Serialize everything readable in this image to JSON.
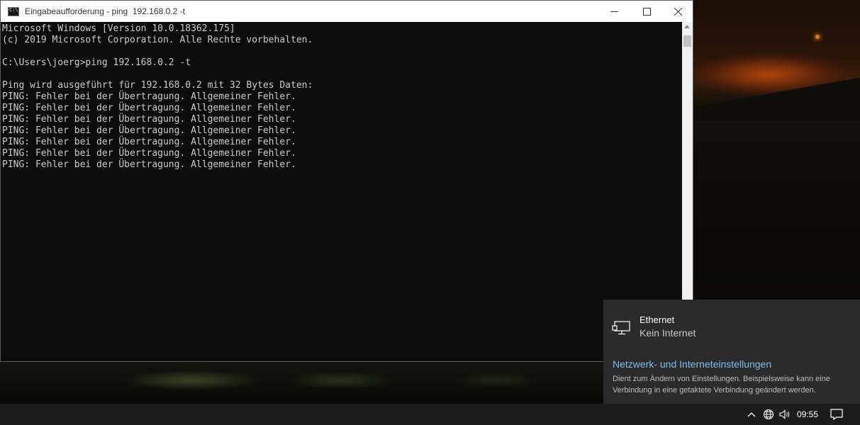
{
  "window": {
    "title": "Eingabeaufforderung - ping  192.168.0.2 -t",
    "icon": "cmd-icon"
  },
  "console": {
    "lines": [
      "Microsoft Windows [Version 10.0.18362.175]",
      "(c) 2019 Microsoft Corporation. Alle Rechte vorbehalten.",
      "",
      "C:\\Users\\joerg>ping 192.168.0.2 -t",
      "",
      "Ping wird ausgeführt für 192.168.0.2 mit 32 Bytes Daten:",
      "PING: Fehler bei der Übertragung. Allgemeiner Fehler.",
      "PING: Fehler bei der Übertragung. Allgemeiner Fehler.",
      "PING: Fehler bei der Übertragung. Allgemeiner Fehler.",
      "PING: Fehler bei der Übertragung. Allgemeiner Fehler.",
      "PING: Fehler bei der Übertragung. Allgemeiner Fehler.",
      "PING: Fehler bei der Übertragung. Allgemeiner Fehler.",
      "PING: Fehler bei der Übertragung. Allgemeiner Fehler."
    ]
  },
  "network_flyout": {
    "name": "Ethernet",
    "status": "Kein Internet",
    "settings_link": "Netzwerk- und Interneteinstellungen",
    "settings_desc": "Dient zum Ändern von Einstellungen. Beispielsweise kann eine Verbindung in eine getaktete Verbindung geändert werden."
  },
  "taskbar": {
    "clock": "09:55",
    "icons": [
      "chevron-up-icon",
      "globe-network-icon",
      "speaker-icon",
      "notification-icon"
    ]
  },
  "colors": {
    "console_bg": "#0c0c0c",
    "console_text": "#cccccc",
    "flyout_bg": "#2b2b2b",
    "link": "#7fbdf0",
    "taskbar_bg": "#1c1c1c"
  }
}
